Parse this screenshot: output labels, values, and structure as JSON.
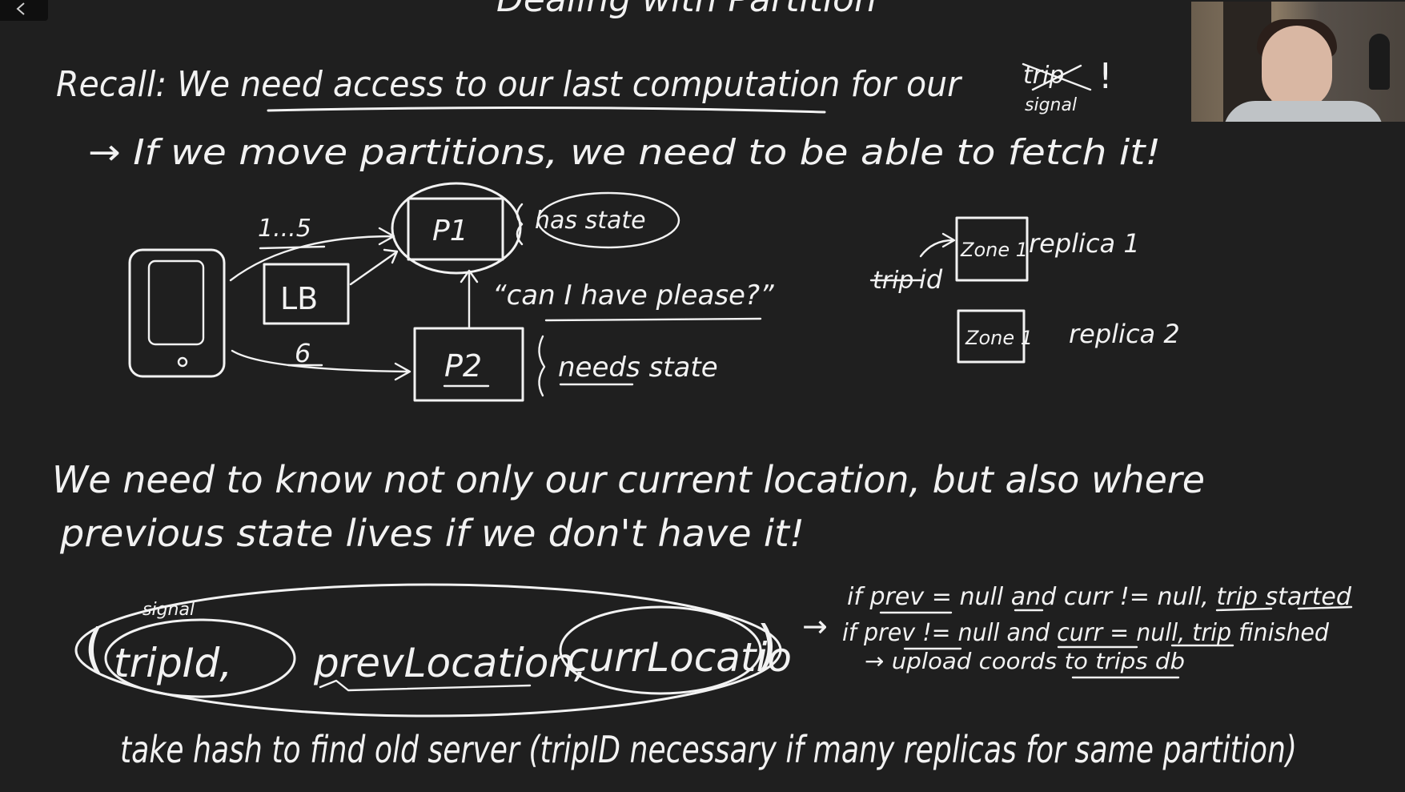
{
  "title": "Dealing with Partition",
  "recall": {
    "line": "Recall: We need access to our last computation for our",
    "struck_word": "trip",
    "replacement_word": "signal",
    "exclaim": "!"
  },
  "if_line": "→ If we move partitions, we need to be able to fetch it!",
  "diagram": {
    "range_1_5": "1...5",
    "lb": "LB",
    "range_6": "6",
    "p1": "P1",
    "p2": "P2",
    "has_state": "has state",
    "needs_state": "needs state",
    "request": "“can I have please?”",
    "trip_id_struck": "trip",
    "trip_id": "id",
    "zone_a": "Zone 1",
    "replica_1": "replica 1",
    "zone_b": "Zone 1",
    "replica_2": "replica 2"
  },
  "know_line_1": "We need to know not only our current location, but also where",
  "know_line_2": "previous state lives if we don't have it!",
  "tuple": {
    "open": "(",
    "signal_note": "signal",
    "trip_id": "tripId,",
    "prev_location": "prevLocation,",
    "curr_location": "currLocatio",
    "close": ")"
  },
  "rules": {
    "arrow": "→",
    "rule_1": "if prev = null and curr != null, trip started",
    "rule_2": "if prev != null and curr = null, trip finished",
    "rule_3": "→ upload coords to trips db"
  },
  "hash_line": "take hash to find old server (tripID necessary if many replicas for same partition)"
}
